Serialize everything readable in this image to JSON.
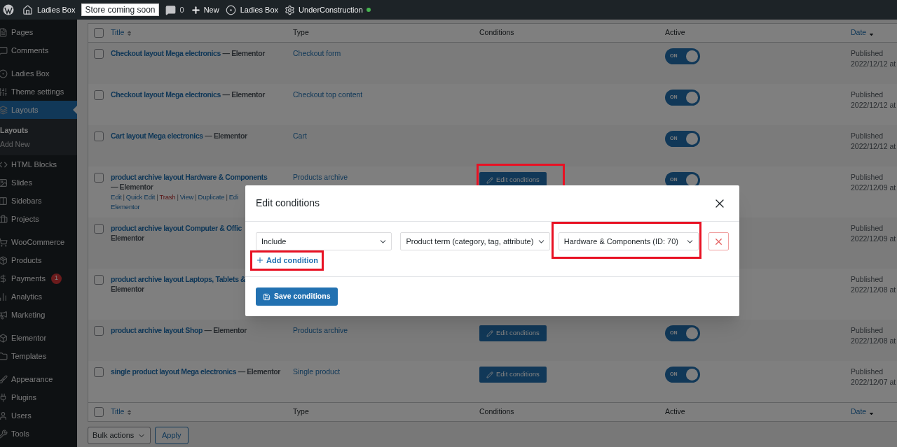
{
  "admin_bar": {
    "items": [
      {
        "kind": "logo"
      },
      {
        "kind": "site",
        "label": "Ladies Box"
      },
      {
        "kind": "badge",
        "label": "Store coming soon"
      },
      {
        "kind": "comments",
        "label": "0"
      },
      {
        "kind": "new",
        "label": "New"
      },
      {
        "kind": "theme",
        "label": "Ladies Box"
      },
      {
        "kind": "plugin",
        "label": "UnderConstruction",
        "active": true
      }
    ]
  },
  "sidebar": {
    "groups": [
      [
        {
          "label": "Pages",
          "selected": false
        },
        {
          "label": "Comments",
          "selected": false
        }
      ],
      [
        {
          "label": "Ladies Box",
          "selected": false
        },
        {
          "label": "Theme settings",
          "selected": false
        },
        {
          "label": "Layouts",
          "selected": true,
          "children": [
            {
              "label": "Layouts",
              "selected": true
            },
            {
              "label": "Add New",
              "selected": false
            }
          ]
        },
        {
          "label": "HTML Blocks",
          "selected": false
        },
        {
          "label": "Slides",
          "selected": false
        },
        {
          "label": "Sidebars",
          "selected": false
        },
        {
          "label": "Projects",
          "selected": false
        }
      ],
      [
        {
          "label": "WooCommerce",
          "selected": false
        },
        {
          "label": "Products",
          "selected": false
        },
        {
          "label": "Payments",
          "selected": false,
          "badge": "1"
        },
        {
          "label": "Analytics",
          "selected": false
        },
        {
          "label": "Marketing",
          "selected": false
        }
      ],
      [
        {
          "label": "Elementor",
          "selected": false
        },
        {
          "label": "Templates",
          "selected": false
        }
      ],
      [
        {
          "label": "Appearance",
          "selected": false
        },
        {
          "label": "Plugins",
          "selected": false
        },
        {
          "label": "Users",
          "selected": false
        },
        {
          "label": "Tools",
          "selected": false
        }
      ]
    ]
  },
  "table": {
    "select_all": {
      "checked": false
    },
    "columns": [
      {
        "label": "Title",
        "sortable": true
      },
      {
        "label": "Type",
        "sortable": false
      },
      {
        "label": "Conditions",
        "sortable": false
      },
      {
        "label": "Active",
        "sortable": false
      },
      {
        "label": "Date",
        "sortable": true
      }
    ],
    "rows": [
      {
        "checked": false,
        "title": "Checkout layout Mega electronics",
        "state": "— Elementor",
        "type": "Checkout form",
        "active": {
          "on": true,
          "label": "ON"
        },
        "status": "Published",
        "date": "2022/12/12 at"
      },
      {
        "checked": false,
        "title": "Checkout layout Mega electronics",
        "state": "— Elementor",
        "type": "Checkout top content",
        "active": {
          "on": true,
          "label": "ON"
        },
        "status": "Published",
        "date": "2022/12/12 at"
      },
      {
        "checked": false,
        "title": "Cart layout Mega electronics",
        "state": "— Elementor",
        "type": "Cart",
        "active": {
          "on": true,
          "label": "ON"
        },
        "status": "Published",
        "date": "2022/12/12 at"
      },
      {
        "checked": false,
        "title": "product archive layout Hardware & Components",
        "state": "— Elementor",
        "actions": [
          [
            {
              "label": "Edit",
              "kind": "link"
            },
            {
              "label": "Quick Edit",
              "kind": "link"
            },
            {
              "label": "Trash",
              "kind": "danger"
            },
            {
              "label": "View",
              "kind": "link"
            },
            {
              "label": "Duplicate",
              "kind": "link"
            },
            {
              "label": "Edi",
              "kind": "link"
            }
          ],
          [
            {
              "label": "Elementor",
              "kind": "link"
            }
          ]
        ],
        "type": "Products archive",
        "conditions": {
          "label": "Edit conditions",
          "highlighted": true
        },
        "active": {
          "on": true,
          "label": "ON"
        },
        "status": "Published",
        "date": "2022/12/09 at"
      },
      {
        "checked": false,
        "title": "product archive layout Computer & Offic",
        "state": "Elementor",
        "status": "Published",
        "date": "2022/12/09 at"
      },
      {
        "checked": false,
        "title": "product archive layout Laptops, Tablets &",
        "state": "Elementor",
        "status": "Published",
        "date": "2022/12/08 at"
      },
      {
        "checked": false,
        "title": "product archive layout Shop",
        "state": "— Elementor",
        "type": "Products archive",
        "conditions": {
          "label": "Edit conditions",
          "highlighted": false
        },
        "active": {
          "on": true,
          "label": "ON"
        },
        "status": "Published",
        "date": "2022/12/08 at"
      },
      {
        "checked": false,
        "title": "single product layout Mega electronics",
        "state": "— Elementor",
        "type": "Single product",
        "conditions": {
          "label": "Edit conditions",
          "highlighted": false
        },
        "active": {
          "on": true,
          "label": "ON"
        },
        "status": "Published",
        "date": "2022/12/07 at"
      }
    ],
    "action_separator": "|",
    "footer_select_all": {
      "checked": false
    },
    "footer_columns": [
      {
        "label": "Title",
        "sortable": true
      },
      {
        "label": "Type",
        "sortable": false
      },
      {
        "label": "Conditions",
        "sortable": false
      },
      {
        "label": "Active",
        "sortable": false
      },
      {
        "label": "Date",
        "sortable": true
      }
    ]
  },
  "bulk": {
    "select": "Bulk actions",
    "apply": "Apply"
  },
  "modal": {
    "title": "Edit conditions",
    "conditions": [
      {
        "fields": [
          {
            "value": "Include",
            "highlighted": false
          },
          {
            "value": "Product term (category, tag, attribute)",
            "highlighted": false
          },
          {
            "value": "Hardware & Components (ID: 70)",
            "highlighted": true
          }
        ]
      }
    ],
    "add": {
      "label": "Add condition",
      "highlighted": true
    },
    "save": "Save conditions"
  }
}
